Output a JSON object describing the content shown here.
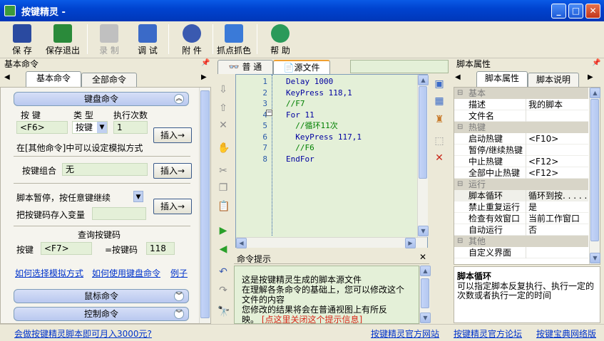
{
  "window": {
    "title": "按键精灵 -"
  },
  "toolbar": [
    {
      "name": "save",
      "label": "保 存",
      "color": "#2a4aa0"
    },
    {
      "name": "save-exit",
      "label": "保存退出",
      "color": "#2a8a3a"
    },
    {
      "name": "record",
      "label": "录 制",
      "color": "#a8a8a8"
    },
    {
      "name": "debug",
      "label": "调 试",
      "color": "#3a6ac8"
    },
    {
      "name": "attachment",
      "label": "附 件",
      "color": "#3a5ab0"
    },
    {
      "name": "capture-color",
      "label": "抓点抓色",
      "color": "#3a7ad8"
    },
    {
      "name": "help",
      "label": "帮 助",
      "color": "#2a9a5a"
    }
  ],
  "left": {
    "panel_title": "基本命令",
    "tabs": [
      "基本命令",
      "全部命令"
    ],
    "keyboard": {
      "header": "键盘命令",
      "col_key": "按 键",
      "col_type": "类 型",
      "col_count": "执行次数",
      "key_value": "<F6>",
      "type_value": "按键",
      "count_value": "1",
      "insert": "插入→",
      "hint": "在[其他命令]中可以设定模拟方式",
      "combo_label": "按键组合",
      "combo_value": "无",
      "pause_label": "脚本暂停，按任意键继续",
      "save_var_label": "把按键码存入变量",
      "query_title": "查询按键码",
      "query_key_label": "按键",
      "query_key_value": "<F7>",
      "query_code_label": "=按键码",
      "query_code_value": "118",
      "link1": "如何选择模拟方式",
      "link2": "如何使用键盘命令",
      "link3": "例子"
    },
    "mouse_header": "鼠标命令",
    "control_header": "控制命令"
  },
  "editor": {
    "tabs": [
      "普 通",
      "源文件"
    ],
    "lines": [
      {
        "n": "1",
        "text": "Delay 1000",
        "color": "#0000a0"
      },
      {
        "n": "2",
        "text": "KeyPress 118,1",
        "color": "#0000a0"
      },
      {
        "n": "3",
        "text": "//F7",
        "color": "#008000"
      },
      {
        "n": "4",
        "text": "For 11",
        "color": "#0000a0"
      },
      {
        "n": "5",
        "text": "  //循环11次",
        "color": "#008000"
      },
      {
        "n": "6",
        "text": "  KeyPress 117,1",
        "color": "#0000a0"
      },
      {
        "n": "7",
        "text": "  //F6",
        "color": "#008000"
      },
      {
        "n": "8",
        "text": "EndFor",
        "color": "#0000a0"
      }
    ]
  },
  "hint_panel": {
    "title": "命令提示",
    "lines": [
      "这是按键精灵生成的脚本源文件",
      "在理解各条命令的基础上，您可以修改这个",
      "文件的内容",
      "您修改的结果将会在普通视图上有所反",
      "映。"
    ],
    "red_tail": "[点这里关闭这个提示信息]"
  },
  "props": {
    "panel_title": "脚本属性",
    "tabs": [
      "脚本属性",
      "脚本说明"
    ],
    "rows": [
      {
        "cat": "基本"
      },
      {
        "k": "描述",
        "v": "我的脚本"
      },
      {
        "k": "文件名",
        "v": ""
      },
      {
        "cat": "热键"
      },
      {
        "k": "启动热键",
        "v": "<F10>"
      },
      {
        "k": "暂停/继续热键",
        "v": ""
      },
      {
        "k": "中止热键",
        "v": "<F12>"
      },
      {
        "k": "全部中止热键",
        "v": "<F12>"
      },
      {
        "cat": "运行"
      },
      {
        "k": "脚本循环",
        "v": "循环到按. . . . ."
      },
      {
        "k": "禁止重复运行",
        "v": "是"
      },
      {
        "k": "检查有效窗口",
        "v": "当前工作窗口"
      },
      {
        "k": "自动运行",
        "v": "否"
      },
      {
        "cat": "其他"
      },
      {
        "k": "自定义界面",
        "v": ""
      }
    ],
    "desc_title": "脚本循环",
    "desc_text": "可以指定脚本反复执行、执行一定的次数或者执行一定的时间"
  },
  "status": {
    "promo": "会做按键精灵脚本即可月入3000元?",
    "link1": "按键精灵官方网站",
    "link2": "按键精灵官方论坛",
    "link3": "按键宝典网络版"
  }
}
